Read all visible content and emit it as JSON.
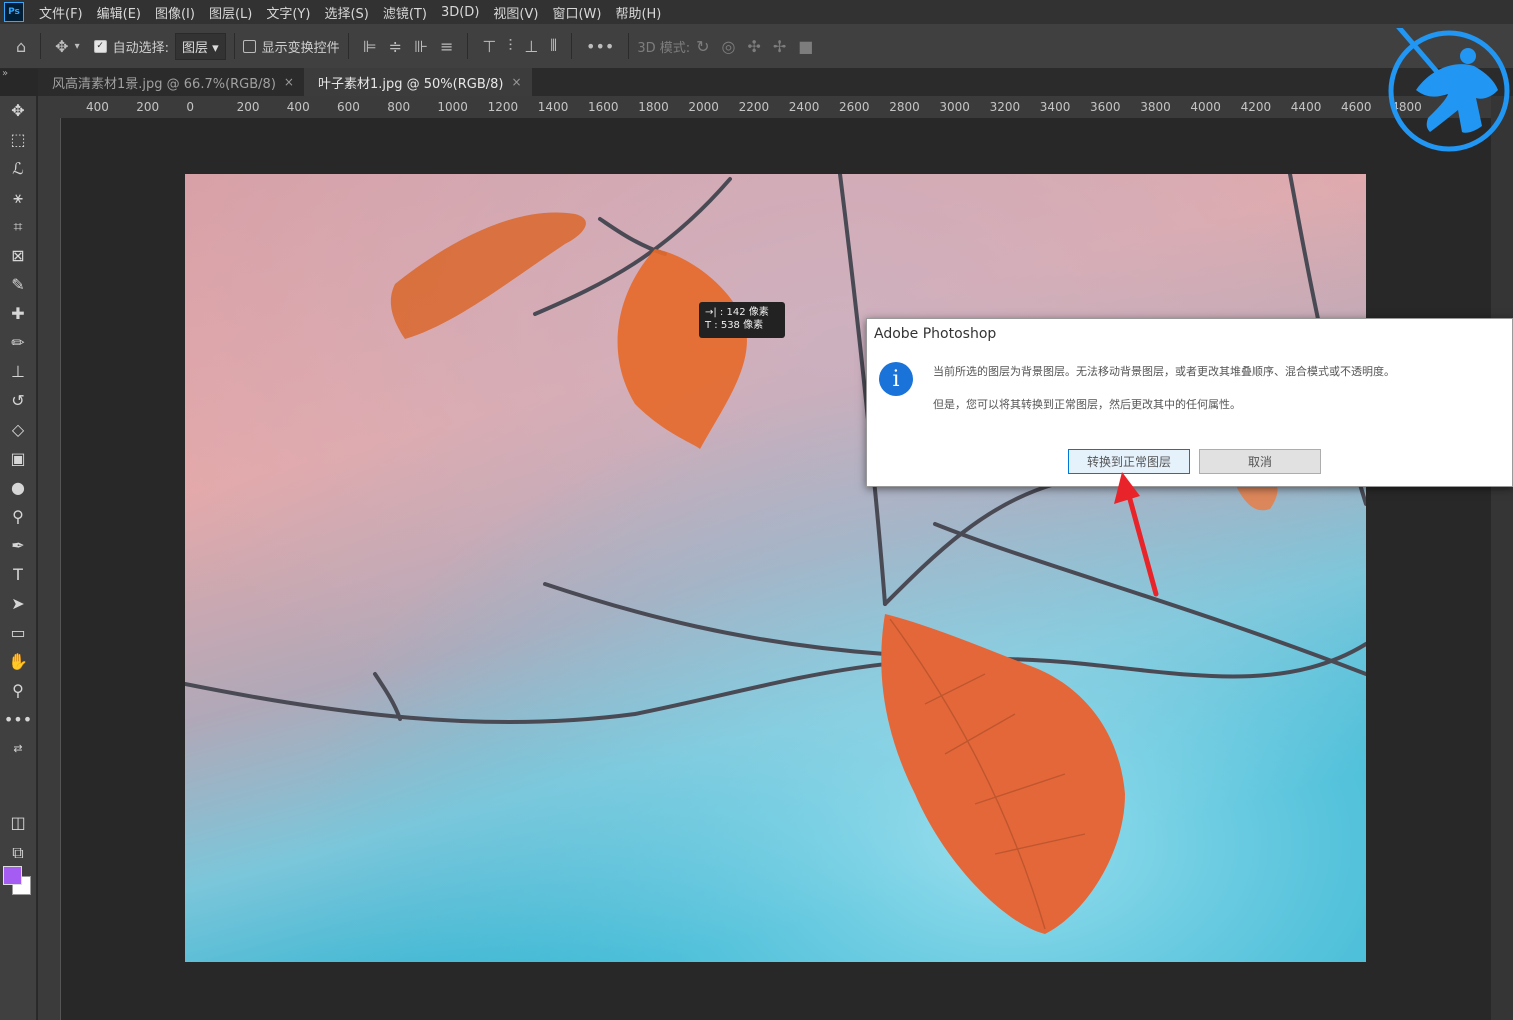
{
  "menubar": {
    "logo": "Ps",
    "items": [
      "文件(F)",
      "编辑(E)",
      "图像(I)",
      "图层(L)",
      "文字(Y)",
      "选择(S)",
      "滤镜(T)",
      "3D(D)",
      "视图(V)",
      "窗口(W)",
      "帮助(H)"
    ]
  },
  "options": {
    "auto_select_label": "自动选择:",
    "auto_select_value": "图层",
    "show_transform_label": "显示变换控件",
    "mode_3d_label": "3D 模式:"
  },
  "tabs": [
    {
      "label": "风高清素材1景.jpg @ 66.7%(RGB/8)",
      "close": "×"
    },
    {
      "label": "叶子素材1.jpg @ 50%(RGB/8)",
      "close": "×"
    }
  ],
  "ruler_ticks": [
    "400",
    "200",
    "0",
    "200",
    "400",
    "600",
    "800",
    "1000",
    "1200",
    "1400",
    "1600",
    "1800",
    "2000",
    "2200",
    "2400",
    "2600",
    "2800",
    "3000",
    "3200",
    "3400",
    "3600",
    "3800",
    "4000",
    "4200",
    "4400",
    "4600",
    "4800"
  ],
  "measure": {
    "line1": "→| : 142 像素",
    "line2": "T : 538 像素"
  },
  "dialog": {
    "title": "Adobe Photoshop",
    "message1": "当前所选的图层为背景图层。无法移动背景图层，或者更改其堆叠顺序、混合模式或不透明度。",
    "message2": "但是，您可以将其转换到正常图层，然后更改其中的任何属性。",
    "convert_button": "转换到正常图层",
    "cancel_button": "取消"
  },
  "colors": {
    "foreground": "#a55cf2",
    "background": "#ffffff",
    "accent": "#1a73d9"
  }
}
